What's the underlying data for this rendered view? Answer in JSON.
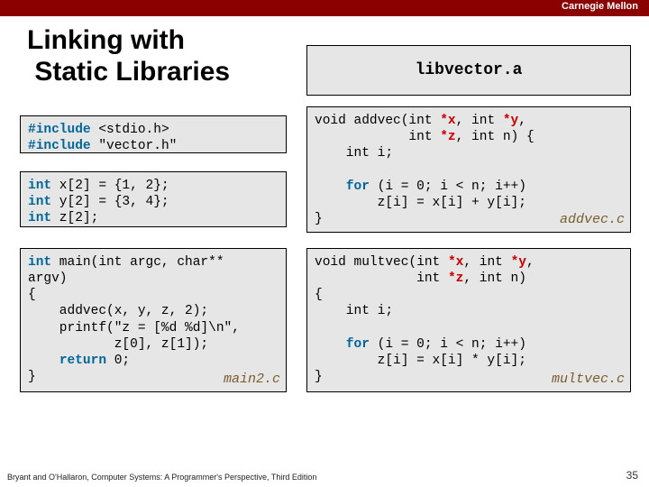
{
  "header": {
    "university": "Carnegie Mellon"
  },
  "title": {
    "line1": "Linking with",
    "line2": "Static Libraries"
  },
  "libbox": {
    "label": "libvector.a"
  },
  "includes": {
    "line1_kw": "#include",
    "line1_rest": " <stdio.h>",
    "line2_kw": "#include",
    "line2_rest": " \"vector.h\""
  },
  "decls": {
    "kw": "int",
    "l1_rest": " x[2] = {1, 2};",
    "l2_rest": " y[2] = {3, 4};",
    "l3_rest": " z[2];"
  },
  "main": {
    "l1_kw": "int",
    "l1_rest": " main(int argc, char**",
    "l2": "argv)",
    "l3": "{",
    "l4": "    addvec(x, y, z, 2);",
    "l5": "    printf(\"z = [%d %d]\\n\",",
    "l6": "           z[0], z[1]);",
    "l7a": "    ",
    "l7_kw": "return",
    "l7b": " 0;",
    "l8": "}",
    "fname": "main2.c"
  },
  "addvec": {
    "l1a": "void addvec(int ",
    "l1_p1": "*x",
    "l1b": ", int ",
    "l1_p2": "*y",
    "l1c": ",",
    "l2a": "            int ",
    "l2_p1": "*z",
    "l2b": ", int n) {",
    "l3": "    int i;",
    "l4": "",
    "l5a": "    ",
    "l5_kw": "for",
    "l5b": " (i = 0; i < n; i++)",
    "l6": "        z[i] = x[i] + y[i];",
    "l7": "}",
    "fname": "addvec.c"
  },
  "multvec": {
    "l1a": "void multvec(int ",
    "l1_p1": "*x",
    "l1b": ", int ",
    "l1_p2": "*y",
    "l1c": ",",
    "l2a": "             int ",
    "l2_p1": "*z",
    "l2b": ", int n)",
    "l3": "{",
    "l4": "    int i;",
    "l5": "",
    "l6a": "    ",
    "l6_kw": "for",
    "l6b": " (i = 0; i < n; i++)",
    "l7": "        z[i] = x[i] * y[i];",
    "l8": "}",
    "fname": "multvec.c"
  },
  "footer": {
    "text": "Bryant and O'Hallaron, Computer Systems: A Programmer's Perspective, Third Edition",
    "page": "35"
  }
}
